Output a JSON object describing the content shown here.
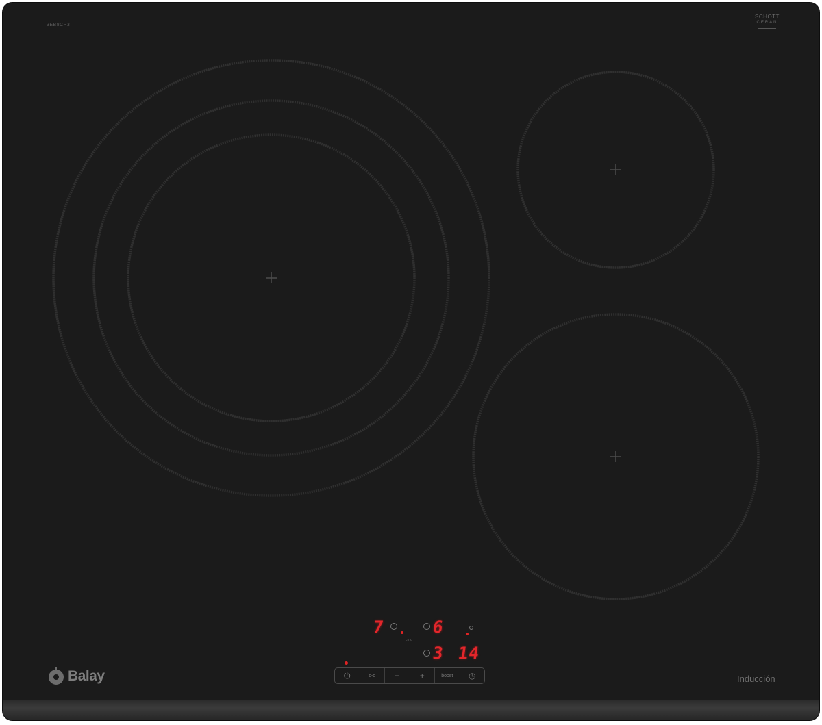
{
  "product": {
    "model_code": "3EB8CP3",
    "glass_brand_line1": "SCHOTT",
    "glass_brand_line2": "CERAN",
    "brand_name": "Balay",
    "technology_label": "Inducción"
  },
  "display": {
    "zone_left_level": "7",
    "zone_top_right_level": "6",
    "zone_bottom_right_level": "3",
    "timer_value": "14",
    "small_label": "c-no"
  },
  "controls": {
    "power_symbol": "⏻",
    "childlock_label": "c-o",
    "minus_label": "−",
    "plus_label": "+",
    "boost_label": "boost",
    "timer_symbol": "◷"
  },
  "colors": {
    "glass": "#1b1b1b",
    "zone_ring": "#333333",
    "led_red": "#e3262b"
  },
  "icons": [
    "balay-logo-icon",
    "power-icon",
    "timer-icon",
    "cross-mark-icon"
  ]
}
